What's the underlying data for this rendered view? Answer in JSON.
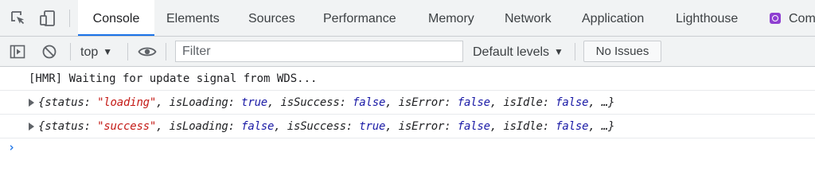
{
  "tabbar": {
    "tabs": [
      {
        "label": "Console",
        "active": true
      },
      {
        "label": "Elements"
      },
      {
        "label": "Sources"
      },
      {
        "label": "Performance"
      },
      {
        "label": "Memory"
      },
      {
        "label": "Network"
      },
      {
        "label": "Application"
      },
      {
        "label": "Lighthouse"
      },
      {
        "label": "Com",
        "icon": "react-components-icon"
      }
    ],
    "icons": [
      "inspect-element-icon",
      "device-toolbar-icon"
    ]
  },
  "toolbar": {
    "context": "top",
    "filter_placeholder": "Filter",
    "levels": "Default levels",
    "issues": "No Issues",
    "icons": [
      "sidebar-toggle-icon",
      "clear-console-icon",
      "live-expression-eye-icon"
    ]
  },
  "console": {
    "messages": [
      {
        "text": "[HMR] Waiting for update signal from WDS..."
      },
      {
        "parts": {
          "open": "{",
          "k1": "status: ",
          "v1": "\"loading\"",
          "k2": ", isLoading: ",
          "v2": "true",
          "k3": ", isSuccess: ",
          "v3": "false",
          "k4": ", isError: ",
          "v4": "false",
          "k5": ", isIdle: ",
          "v5": "false",
          "close": ", …}"
        }
      },
      {
        "parts": {
          "open": "{",
          "k1": "status: ",
          "v1": "\"success\"",
          "k2": ", isLoading: ",
          "v2": "false",
          "k3": ", isSuccess: ",
          "v3": "true",
          "k4": ", isError: ",
          "v4": "false",
          "k5": ", isIdle: ",
          "v5": "false",
          "close": ", …}"
        }
      }
    ],
    "prompt": "›"
  },
  "colors": {
    "accent": "#1a73e8",
    "string": "#c41a16",
    "boolean": "#1a1aa6",
    "toolbar_bg": "#f1f3f4"
  }
}
